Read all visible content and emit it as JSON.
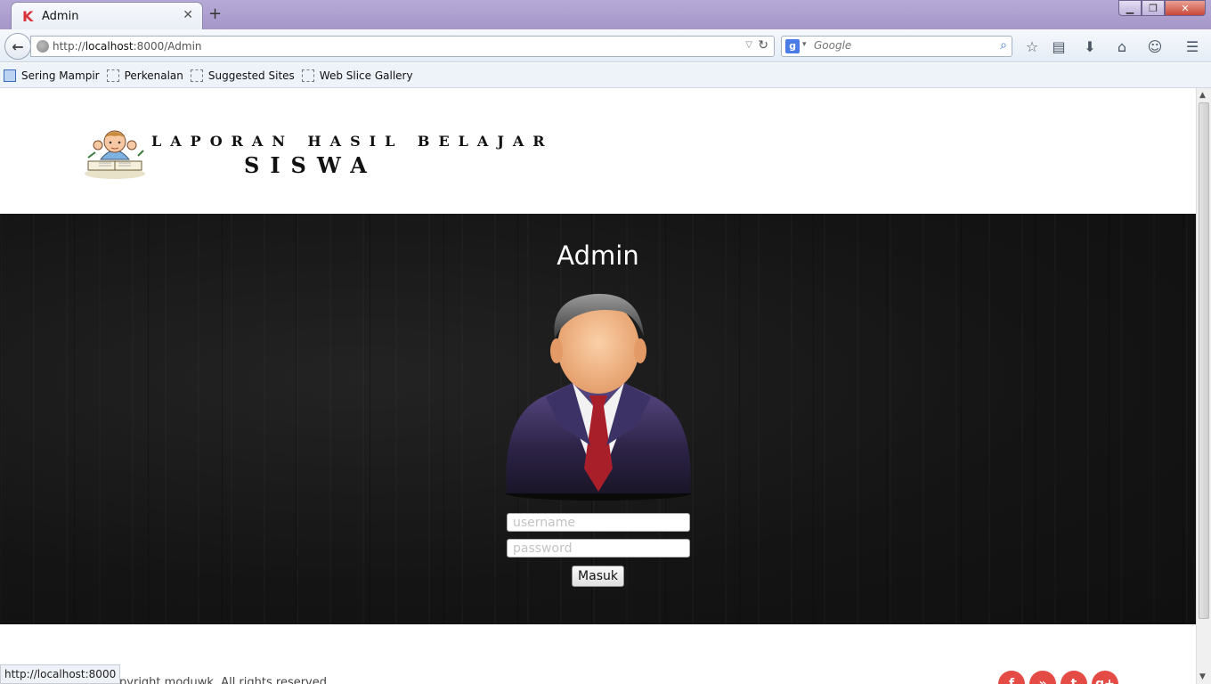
{
  "browser": {
    "tab_title": "Admin",
    "tab_favicon": "K",
    "url_prefix": "http://",
    "url_host": "localhost",
    "url_rest": ":8000/Admin",
    "search_placeholder": "Google",
    "search_engine_letter": "g",
    "status_url": "http://localhost:8000"
  },
  "bookmarks": [
    {
      "label": "Sering Mampir"
    },
    {
      "label": "Perkenalan"
    },
    {
      "label": "Suggested Sites"
    },
    {
      "label": "Web Slice Gallery"
    }
  ],
  "site": {
    "brand_line1": "LAPORAN HASIL BELAJAR",
    "brand_line2": "SISWA"
  },
  "login": {
    "title": "Admin",
    "username_placeholder": "username",
    "password_placeholder": "password",
    "submit_label": "Masuk"
  },
  "footer": {
    "copyright": "Copyright moduwk. All rights reserved.",
    "social": [
      {
        "icon": "facebook-icon",
        "glyph": "f"
      },
      {
        "icon": "rss-icon",
        "glyph": "»"
      },
      {
        "icon": "twitter-icon",
        "glyph": "t"
      },
      {
        "icon": "google-plus-icon",
        "glyph": "g+"
      }
    ]
  },
  "colors": {
    "accent_social": "#e34b44",
    "hero_background": "#151515",
    "titlebar": "#a596c9"
  }
}
